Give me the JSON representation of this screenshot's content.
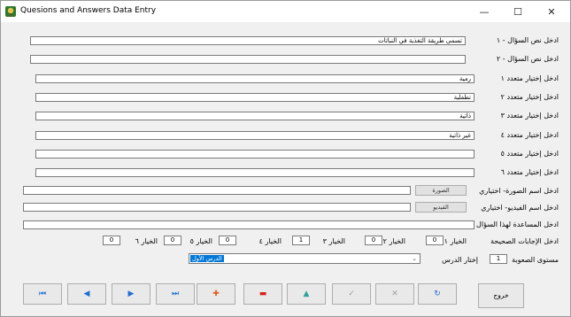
{
  "window": {
    "title": "Quesions and Answers Data Entry",
    "minimize_glyph": "—",
    "maximize_glyph": "☐",
    "close_glyph": "✕"
  },
  "fields": {
    "question1": {
      "label": "ادخل نص السؤال - ١",
      "value": "تسمى طريقة التغذية في النباتات"
    },
    "question2": {
      "label": "ادخل نص السؤال - ٢",
      "value": ""
    },
    "choice1": {
      "label": "ادخل إختيار متعدد ١",
      "value": "رمية"
    },
    "choice2": {
      "label": "ادخل إختيار متعدد ٢",
      "value": "تطفلية"
    },
    "choice3": {
      "label": "ادخل إختيار متعدد ٣",
      "value": "ذاتية"
    },
    "choice4": {
      "label": "ادخل إختيار متعدد ٤",
      "value": "غير ذاتية"
    },
    "choice5": {
      "label": "ادخل إختيار متعدد ٥",
      "value": ""
    },
    "choice6": {
      "label": "ادخل إختيار متعدد ٦",
      "value": ""
    },
    "image": {
      "label": "ادخل اسم الصورة- اختياري",
      "value": "",
      "button": "الصورة"
    },
    "video": {
      "label": "ادخل اسم الفيديو- اختياري",
      "value": "",
      "button": "الفيديو"
    },
    "help": {
      "label": "ادخل المساعدة لهذا السؤال",
      "value": ""
    }
  },
  "answers": {
    "label": "ادخل الإجابات الصحيحة",
    "items": [
      {
        "label": "الخيار ١",
        "value": "0"
      },
      {
        "label": "الخيار ٢",
        "value": "0"
      },
      {
        "label": "الخيار ٣",
        "value": "1"
      },
      {
        "label": "الخيار ٤",
        "value": "0"
      },
      {
        "label": "الخيار ٥",
        "value": "0"
      },
      {
        "label": "الخيار ٦",
        "value": "0"
      }
    ]
  },
  "difficulty": {
    "label": "مستوى الصعوبة",
    "value": "1"
  },
  "lesson": {
    "label": "إختار الدرس",
    "selected": "الدرس الأول"
  },
  "nav": {
    "first": "⏮",
    "prev": "◀",
    "next": "▶",
    "last": "⏭",
    "add": "✚",
    "delete": "▬",
    "up": "▲",
    "save": "✓",
    "cancel": "✕",
    "refresh": "↻",
    "exit_label": "خروج"
  },
  "colors": {
    "nav_icon": "#1c6fd1",
    "add_icon": "#e05a1a",
    "delete_icon": "#d81e1e",
    "up_icon": "#2aa39a",
    "disabled_icon": "#9e9e9e",
    "selection": "#0078d7"
  }
}
